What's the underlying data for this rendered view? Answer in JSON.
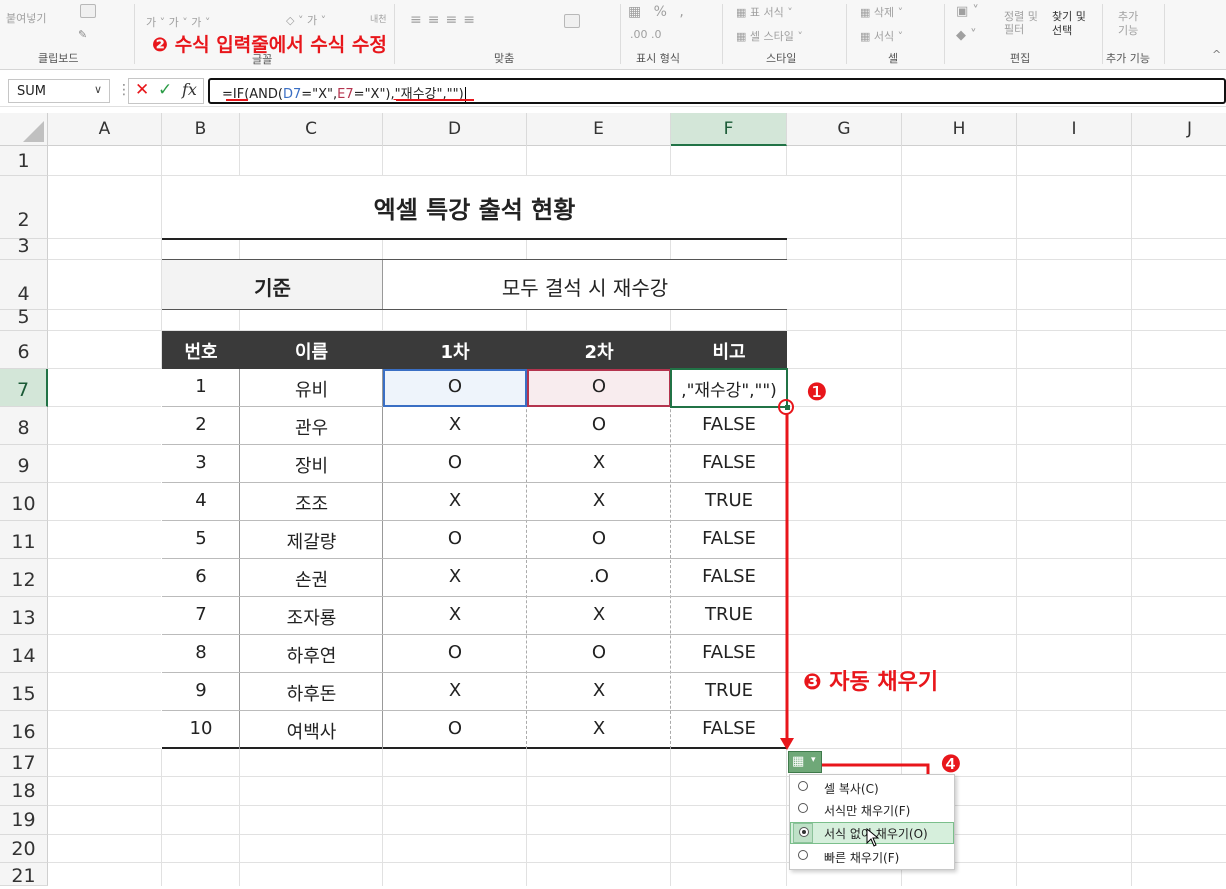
{
  "ribbon": {
    "groups": [
      {
        "label": "클립보드"
      },
      {
        "label": "글꼴"
      },
      {
        "label": "맞춤"
      },
      {
        "label": "표시 형식"
      },
      {
        "label": "스타일"
      },
      {
        "label": "셀"
      },
      {
        "label": "편집"
      },
      {
        "label": "추가 기능"
      }
    ],
    "items": {
      "paste": "붙여넣기",
      "cond_format": "표 서식",
      "cell_style": "셀 스타일",
      "delete": "삭제",
      "format": "서식",
      "sort": "정렬 및 필터",
      "find": "찾기 및 선택",
      "addin": "추가 기능"
    }
  },
  "formula_bar": {
    "name_box": "SUM",
    "fx_label": "fx",
    "formula_parts": [
      "=",
      "IF",
      "(AND(",
      "D7",
      "=\"X\",",
      "E7",
      "=\"X\")",
      ",\"재수강\",\"\")"
    ]
  },
  "columns": [
    "A",
    "B",
    "C",
    "D",
    "E",
    "F",
    "G",
    "H",
    "I",
    "J"
  ],
  "rows": [
    "1",
    "2",
    "3",
    "4",
    "5",
    "6",
    "7",
    "8",
    "9",
    "10",
    "11",
    "12",
    "13",
    "14",
    "15",
    "16",
    "17",
    "18",
    "19",
    "20",
    "21"
  ],
  "sheet": {
    "title": "엑셀 특강 출석 현황",
    "criteria_label": "기준",
    "criteria_value": "모두 결석 시 재수강",
    "headers": [
      "번호",
      "이름",
      "1차",
      "2차",
      "비고"
    ],
    "data_rows": [
      [
        "1",
        "유비",
        "O",
        "O",
        ",\"재수강\",\"\")"
      ],
      [
        "2",
        "관우",
        "X",
        "O",
        "FALSE"
      ],
      [
        "3",
        "장비",
        "O",
        "X",
        "FALSE"
      ],
      [
        "4",
        "조조",
        "X",
        "X",
        "TRUE"
      ],
      [
        "5",
        "제갈량",
        "O",
        "O",
        "FALSE"
      ],
      [
        "6",
        "손권",
        "X",
        ".O",
        "FALSE"
      ],
      [
        "7",
        "조자룡",
        "X",
        "X",
        "TRUE"
      ],
      [
        "8",
        "하후연",
        "O",
        "O",
        "FALSE"
      ],
      [
        "9",
        "하후돈",
        "X",
        "X",
        "TRUE"
      ],
      [
        "10",
        "여백사",
        "O",
        "X",
        "FALSE"
      ]
    ]
  },
  "annotations": {
    "step1": "❶",
    "step2": "❷ 수식 입력줄에서 수식 수정",
    "step3": "❸ 자동 채우기",
    "step4": "❹"
  },
  "autofill_menu": {
    "options": [
      "셀 복사(C)",
      "서식만 채우기(F)",
      "서식 없이 채우기(O)",
      "빠른 채우기(F)"
    ],
    "selected_index": 2
  },
  "colors": {
    "accent_red": "#e8161b",
    "header_dark": "#3a3a3a",
    "excel_green": "#217346",
    "d_ref_blue": "#3a6fc4",
    "e_ref_red": "#b4344e"
  }
}
